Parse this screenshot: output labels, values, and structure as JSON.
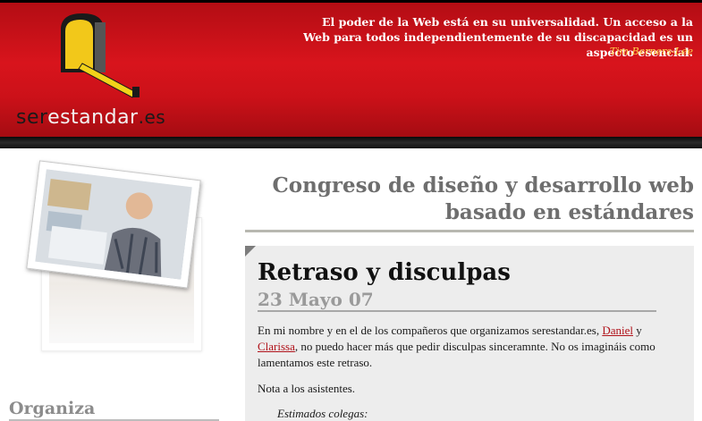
{
  "header": {
    "logo": {
      "ser": "ser",
      "estandar": "estandar",
      "es": ".es"
    },
    "quote": "El poder de la Web está en su universalidad. Un acceso a la Web para todos independientemente de su discapacidad es un aspecto esencial.",
    "quote_author": "Tim Berners-Lee"
  },
  "main": {
    "title_line1": "Congreso de diseño y desarrollo web",
    "title_line2": "basado en estándares",
    "article": {
      "title": "Retraso y disculpas",
      "date": "23 Mayo 07",
      "p1_a": "En mi nombre y en el de los compañeros que organizamos serestandar.es, ",
      "link1": "Daniel",
      "p1_b": " y ",
      "link2": "Clarissa",
      "p1_c": ", no puedo hacer más que pedir disculpas sinceramnte. No os imagináis como lamentamos este retraso.",
      "p2": "Nota a los asistentes.",
      "p3": "Estimados colegas:"
    }
  },
  "sidebar": {
    "heading": "Organiza"
  },
  "colors": {
    "header_red": "#d8141c",
    "author_yellow": "#ffd24a",
    "link_red": "#b0121a"
  }
}
